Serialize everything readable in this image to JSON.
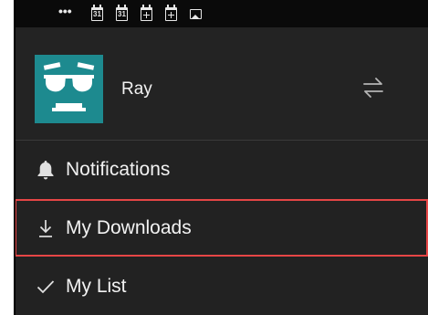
{
  "status_bar": {
    "overflow_glyph": "•••",
    "calendar_icons": [
      {
        "name": "calendar-icon",
        "text": "31"
      },
      {
        "name": "calendar-icon",
        "text": "31"
      },
      {
        "name": "calendar-grid-icon",
        "text": ""
      },
      {
        "name": "calendar-grid-icon",
        "text": ""
      }
    ],
    "last_icon": "image-icon"
  },
  "profile": {
    "username": "Ray",
    "avatar_color": "#1d8a8f",
    "avatar_icon": "sunglasses-face-icon",
    "switch_icon": "switch-profile-icon"
  },
  "menu": {
    "items": [
      {
        "label": "Notifications",
        "icon": "bell-icon"
      },
      {
        "label": "My Downloads",
        "icon": "download-icon",
        "highlight_color": "#e64646"
      },
      {
        "label": "My List",
        "icon": "checkmark-icon"
      }
    ]
  },
  "colors": {
    "background": "#222222",
    "status_bar": "#0a0a0a",
    "text": "#f2f2f2",
    "highlight": "#e64646"
  }
}
